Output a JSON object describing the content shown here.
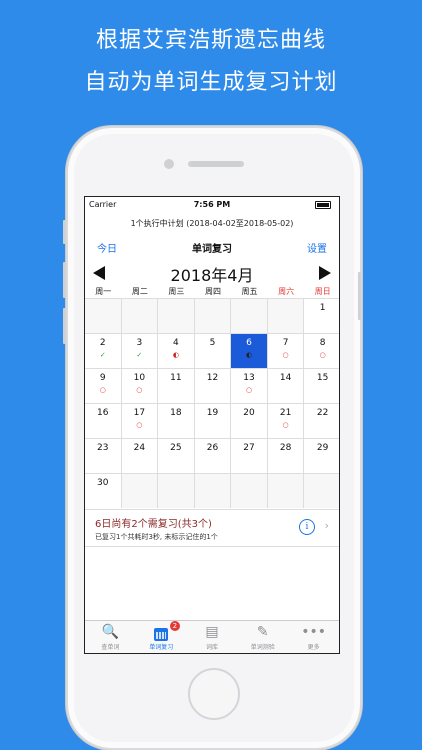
{
  "headline": {
    "line1": "根据艾宾浩斯遗忘曲线",
    "line2": "自动为单词生成复习计划"
  },
  "statusbar": {
    "carrier": "Carrier",
    "time": "7:56 PM"
  },
  "plan_text": "1个执行中计划 (2018-04-02至2018-05-02)",
  "nav": {
    "left": "今日",
    "title": "单词复习",
    "right": "设置"
  },
  "calendar": {
    "month_title": "2018年4月",
    "weekdays": [
      "周一",
      "周二",
      "周三",
      "周四",
      "周五",
      "周六",
      "周日"
    ],
    "rows": [
      [
        {
          "d": ""
        },
        {
          "d": ""
        },
        {
          "d": ""
        },
        {
          "d": ""
        },
        {
          "d": ""
        },
        {
          "d": ""
        },
        {
          "d": "1"
        }
      ],
      [
        {
          "d": "2",
          "m": "✓"
        },
        {
          "d": "3",
          "m": "✓"
        },
        {
          "d": "4",
          "m": "◐"
        },
        {
          "d": "5"
        },
        {
          "d": "6",
          "m": "◐",
          "today": true
        },
        {
          "d": "7",
          "m": "○"
        },
        {
          "d": "8",
          "m": "○"
        }
      ],
      [
        {
          "d": "9",
          "m": "○"
        },
        {
          "d": "10",
          "m": "○"
        },
        {
          "d": "11"
        },
        {
          "d": "12"
        },
        {
          "d": "13",
          "m": "○"
        },
        {
          "d": "14"
        },
        {
          "d": "15"
        }
      ],
      [
        {
          "d": "16"
        },
        {
          "d": "17",
          "m": "○"
        },
        {
          "d": "18"
        },
        {
          "d": "19"
        },
        {
          "d": "20"
        },
        {
          "d": "21",
          "m": "○"
        },
        {
          "d": "22"
        }
      ],
      [
        {
          "d": "23"
        },
        {
          "d": "24"
        },
        {
          "d": "25"
        },
        {
          "d": "26"
        },
        {
          "d": "27"
        },
        {
          "d": "28"
        },
        {
          "d": "29"
        }
      ],
      [
        {
          "d": "30"
        },
        {
          "d": ""
        },
        {
          "d": ""
        },
        {
          "d": ""
        },
        {
          "d": ""
        },
        {
          "d": ""
        },
        {
          "d": ""
        }
      ]
    ]
  },
  "info": {
    "title": "6日尚有2个需复习(共3个)",
    "subtitle": "已复习1个共耗时3秒, 未标示记住的1个",
    "info_icon": "info-icon",
    "chevron": "›"
  },
  "tabs": [
    {
      "label": "查单词",
      "icon": "magnifier-icon",
      "glyph": "🔍"
    },
    {
      "label": "单词复习",
      "icon": "calendar-icon",
      "badge": "2",
      "active": true
    },
    {
      "label": "词库",
      "icon": "notebook-icon",
      "glyph": "▤"
    },
    {
      "label": "单词测验",
      "icon": "edit-icon",
      "glyph": "✎"
    },
    {
      "label": "更多",
      "icon": "more-icon",
      "glyph": "•••"
    }
  ],
  "colors": {
    "background": "#2f8bea",
    "accent": "#1a73e8",
    "today_fill": "#1b5ad8",
    "weekend_red": "#e53935"
  }
}
